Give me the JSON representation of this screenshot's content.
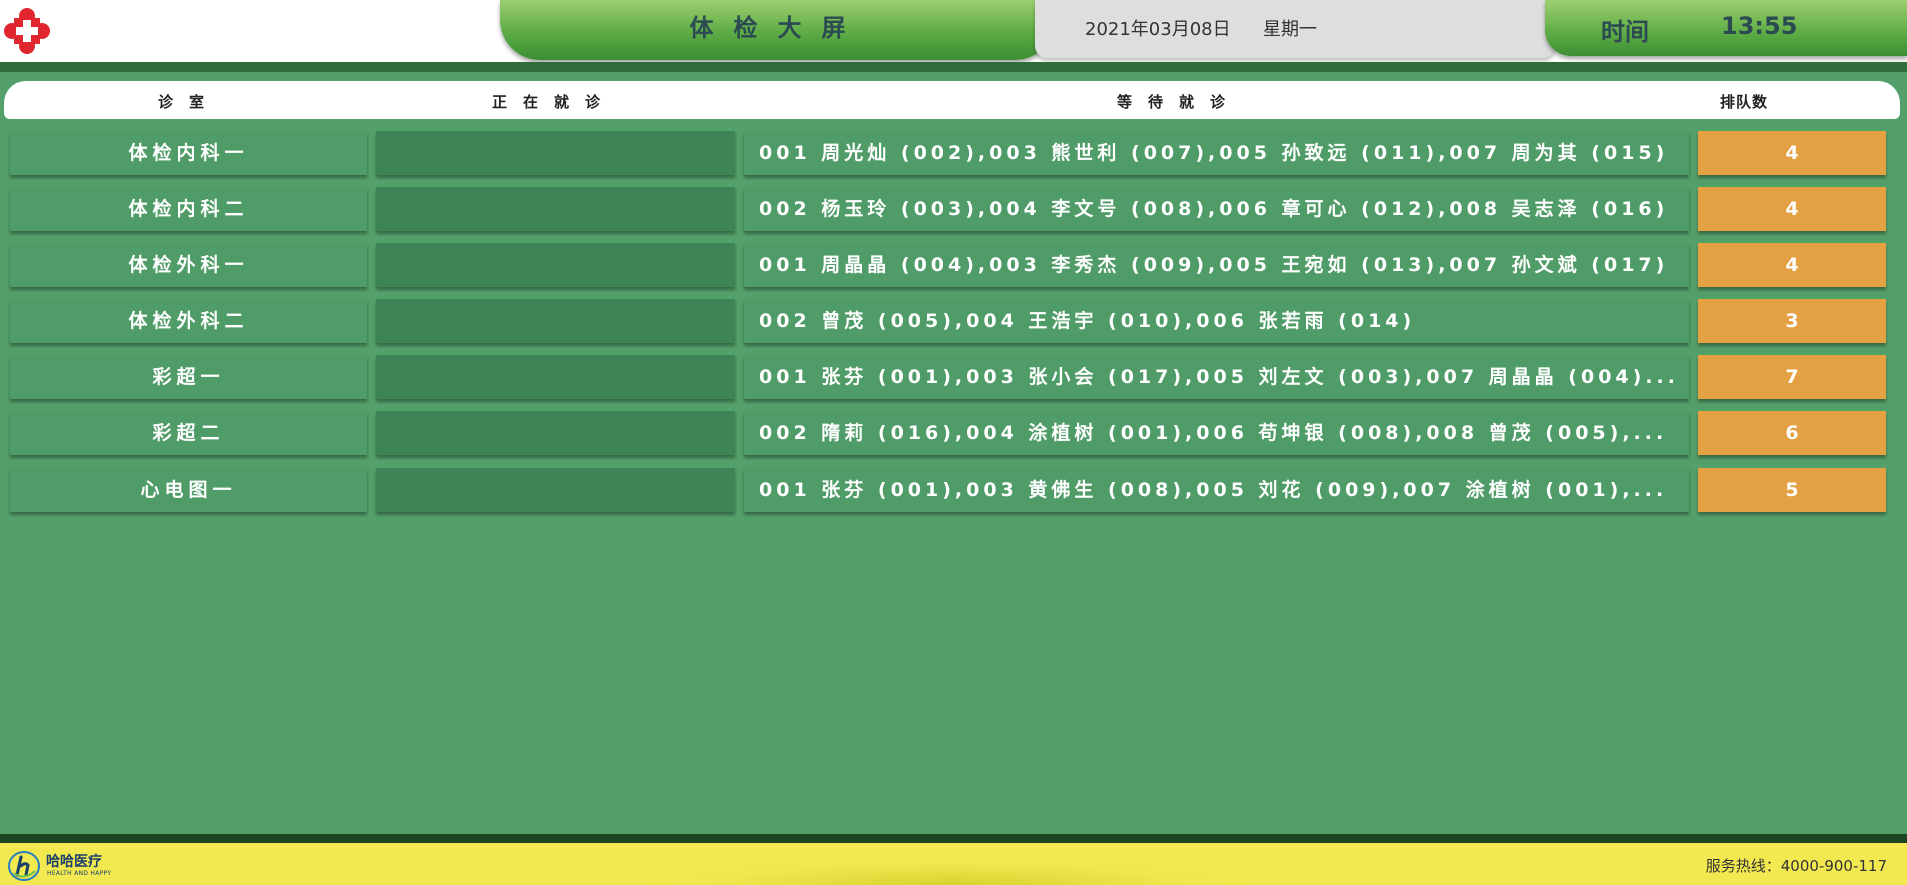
{
  "header": {
    "title": "体检大屏",
    "date": "2021年03月08日",
    "weekday": "星期一",
    "time_label": "时间",
    "time": "13:55"
  },
  "table": {
    "columns": {
      "room": "诊室",
      "current": "正在就诊",
      "waiting": "等待就诊",
      "queue": "排队数"
    },
    "rows": [
      {
        "room": "体检内科一",
        "current": "",
        "waiting": "001 周光灿 (002),003 熊世利 (007),005 孙致远 (011),007 周为其 (015)",
        "queue": "4"
      },
      {
        "room": "体检内科二",
        "current": "",
        "waiting": "002 杨玉玲 (003),004 李文号 (008),006 章可心 (012),008 吴志泽 (016)",
        "queue": "4"
      },
      {
        "room": "体检外科一",
        "current": "",
        "waiting": "001 周晶晶 (004),003 李秀杰 (009),005 王宛如 (013),007 孙文斌 (017)",
        "queue": "4"
      },
      {
        "room": "体检外科二",
        "current": "",
        "waiting": "002 曾茂 (005),004 王浩宇 (010),006 张若雨 (014)",
        "queue": "3"
      },
      {
        "room": "彩超一",
        "current": "",
        "waiting": "001 张芬 (001),003 张小会 (017),005 刘左文 (003),007 周晶晶 (004)...",
        "queue": "7"
      },
      {
        "room": "彩超二",
        "current": "",
        "waiting": "002 隋莉 (016),004 涂植树 (001),006 苟坤银 (008),008 曾茂 (005),...",
        "queue": "6"
      },
      {
        "room": "心电图一",
        "current": "",
        "waiting": "001 张芬 (001),003 黄佛生 (008),005 刘花 (009),007 涂植树 (001),...",
        "queue": "5"
      }
    ]
  },
  "footer": {
    "brand_name": "哈哈医疗",
    "brand_sub": "HEALTH AND HAPPY",
    "hotline": "服务热线：4000-900-117"
  },
  "icons": {
    "logo": "red-cross-logo-icon",
    "brand": "brand-logo-icon"
  },
  "colors": {
    "background": "#54a06a",
    "accent_green": "#5cab44",
    "queue_orange": "#e3a143",
    "footer_yellow": "#f2e84f",
    "logo_red": "#e0262f"
  }
}
